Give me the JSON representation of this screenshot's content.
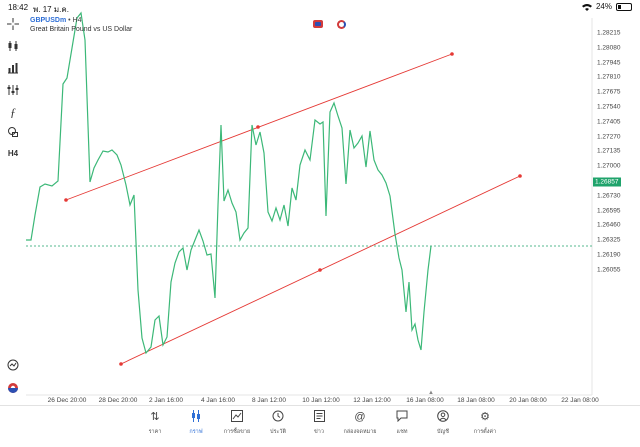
{
  "status_bar": {
    "time": "18:42",
    "date": "พ. 17 ม.ค.",
    "battery": "24%",
    "battery_level": 0.24
  },
  "symbol": {
    "name": "GBPUSDm",
    "timeframe": "• H4",
    "description": "Great Britain Pound vs US Dollar"
  },
  "left_toolbar": {
    "timeframe_label": "H4",
    "icons": [
      "crosshair-icon",
      "candlestick-icon",
      "bar-chart-icon",
      "indicators-icon",
      "function-icon",
      "shapes-icon",
      "timeframe-label",
      "alarm-icon",
      "layers-icon"
    ]
  },
  "price_axis": {
    "labels": [
      "1.28215",
      "1.28080",
      "1.27945",
      "1.27810",
      "1.27675",
      "1.27540",
      "1.27405",
      "1.27270",
      "1.27135",
      "1.27000",
      "1.26730",
      "1.26595",
      "1.26460",
      "1.26325",
      "1.26190",
      "1.26055"
    ],
    "current_price": "1.26857"
  },
  "time_axis": {
    "labels": [
      "26 Dec 20:00",
      "28 Dec 20:00",
      "2 Jan 16:00",
      "4 Jan 16:00",
      "8 Jan 12:00",
      "10 Jan 12:00",
      "12 Jan 12:00",
      "16 Jan 08:00",
      "18 Jan 08:00",
      "20 Jan 08:00",
      "22 Jan 08:00"
    ]
  },
  "colors": {
    "price_line": "#3cb878",
    "trend_line": "#e53935",
    "current_price_line": "#1fa36b",
    "accent": "#2e6fd6"
  },
  "bottom_nav": {
    "items": [
      {
        "label": "ราคา",
        "icon": "quotes-icon"
      },
      {
        "label": "กราฟ",
        "icon": "chart-icon",
        "active": true
      },
      {
        "label": "การซื้อขาย",
        "icon": "trade-icon"
      },
      {
        "label": "ประวัติ",
        "icon": "history-icon"
      },
      {
        "label": "ข่าว",
        "icon": "news-icon"
      },
      {
        "label": "กล่องจดหมาย",
        "icon": "mailbox-icon"
      },
      {
        "label": "แชท",
        "icon": "chat-icon"
      },
      {
        "label": "บัญชี",
        "icon": "account-icon"
      },
      {
        "label": "การตั้งค่า",
        "icon": "settings-icon"
      }
    ]
  }
}
